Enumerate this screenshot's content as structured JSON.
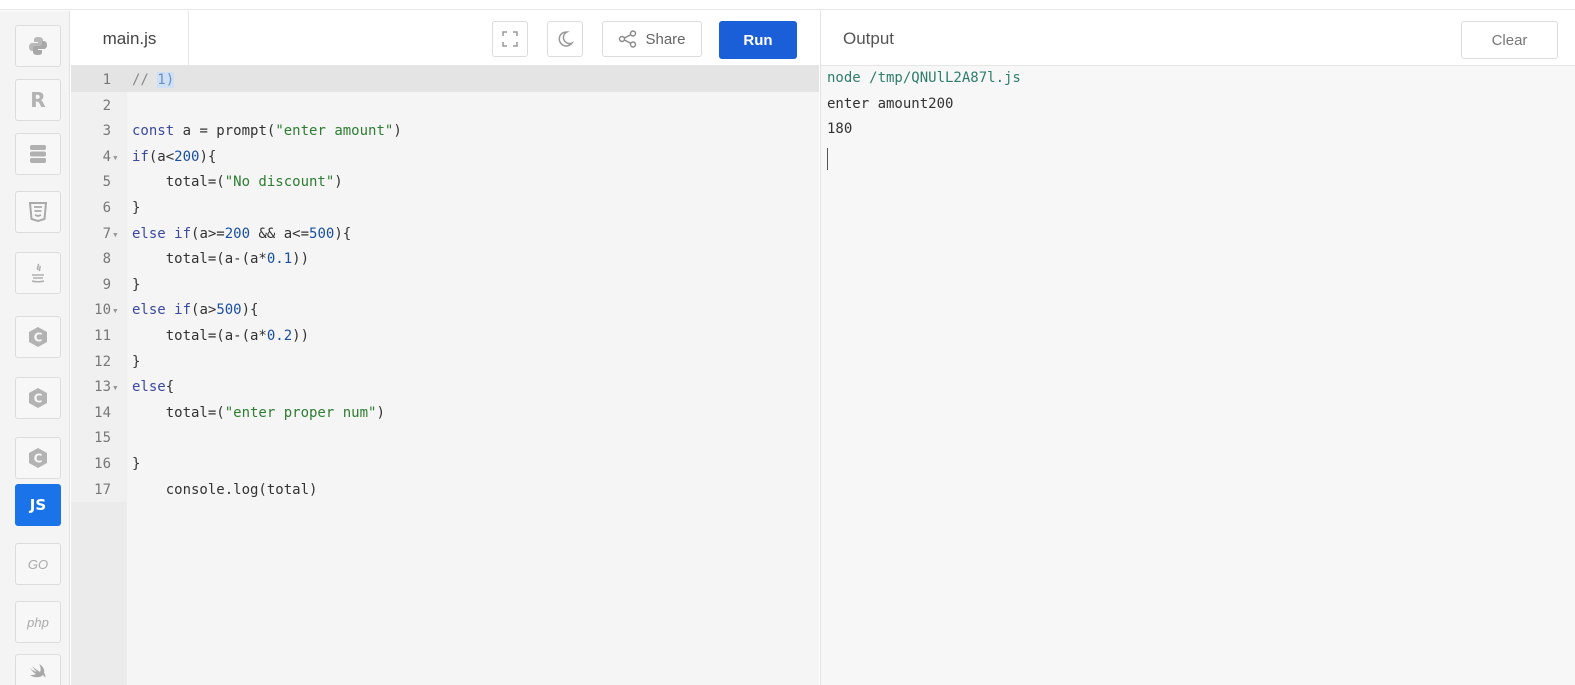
{
  "sidebar": {
    "languages": [
      {
        "name": "python",
        "icon": "python-icon"
      },
      {
        "name": "r",
        "icon": "r-icon",
        "glyph": "R"
      },
      {
        "name": "sql",
        "icon": "database-icon"
      },
      {
        "name": "html",
        "icon": "html5-icon"
      },
      {
        "name": "java",
        "icon": "java-icon"
      },
      {
        "name": "c",
        "icon": "c-icon",
        "glyph": "C"
      },
      {
        "name": "cpp",
        "icon": "cpp-icon",
        "glyph": "C"
      },
      {
        "name": "csharp",
        "icon": "csharp-icon",
        "glyph": "C"
      },
      {
        "name": "javascript",
        "icon": "js-icon",
        "glyph": "JS",
        "active": true
      },
      {
        "name": "go",
        "icon": "go-icon",
        "glyph": "GO"
      },
      {
        "name": "php",
        "icon": "php-icon",
        "glyph": "php"
      },
      {
        "name": "swift",
        "icon": "swift-icon"
      }
    ]
  },
  "editor": {
    "file_name": "main.js",
    "share_label": "Share",
    "run_label": "Run",
    "lines": [
      {
        "n": "1",
        "fold": false
      },
      {
        "n": "2",
        "fold": false
      },
      {
        "n": "3",
        "fold": false
      },
      {
        "n": "4",
        "fold": true
      },
      {
        "n": "5",
        "fold": false
      },
      {
        "n": "6",
        "fold": false
      },
      {
        "n": "7",
        "fold": true
      },
      {
        "n": "8",
        "fold": false
      },
      {
        "n": "9",
        "fold": false
      },
      {
        "n": "10",
        "fold": true
      },
      {
        "n": "11",
        "fold": false
      },
      {
        "n": "12",
        "fold": false
      },
      {
        "n": "13",
        "fold": true
      },
      {
        "n": "14",
        "fold": false
      },
      {
        "n": "15",
        "fold": false
      },
      {
        "n": "16",
        "fold": false
      },
      {
        "n": "17",
        "fold": false
      }
    ],
    "code": {
      "l1_comment": "// ",
      "l1_hl": "1)",
      "l3_a": "const",
      "l3_b": " a = prompt(",
      "l3_c": "\"enter amount\"",
      "l3_d": ")",
      "l4_a": "if",
      "l4_b": "(a<",
      "l4_c": "200",
      "l4_d": "){",
      "l5_a": "    total=(",
      "l5_b": "\"No discount\"",
      "l5_c": ")",
      "l6": "}",
      "l7_a": "else if",
      "l7_b": "(a>=",
      "l7_c": "200",
      "l7_d": " && a<=",
      "l7_e": "500",
      "l7_f": "){",
      "l8_a": "    total=(a-(a*",
      "l8_b": "0.1",
      "l8_c": "))",
      "l9": "}",
      "l10_a": "else if",
      "l10_b": "(a>",
      "l10_c": "500",
      "l10_d": "){",
      "l11_a": "    total=(a-(a*",
      "l11_b": "0.2",
      "l11_c": "))",
      "l12": "}",
      "l13_a": "else",
      "l13_b": "{",
      "l14_a": "    total=(",
      "l14_b": "\"enter proper num\"",
      "l14_c": ")",
      "l16": "}",
      "l17": "    console.log(total)"
    }
  },
  "output": {
    "title": "Output",
    "clear_label": "Clear",
    "command": "node /tmp/QNUlL2A87l.js",
    "line1": "enter amount200",
    "line2": "180"
  }
}
